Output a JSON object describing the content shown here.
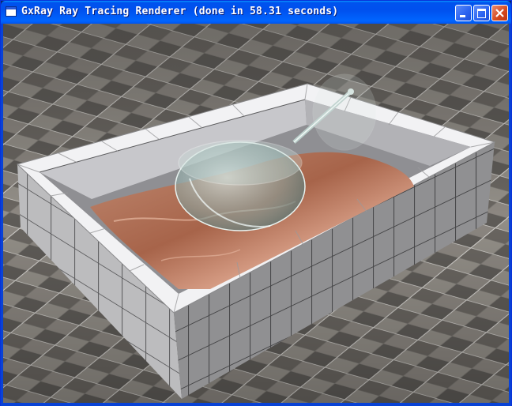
{
  "window": {
    "title": "GxRay Ray Tracing Renderer (done in 58.31 seconds)",
    "icon": "app-window-icon",
    "controls": {
      "minimize": "minimize-icon",
      "maximize": "maximize-icon",
      "close": "close-icon"
    }
  },
  "render": {
    "scene_description_icon": "rendered-scene",
    "colors": {
      "floor_dark": "#4a4845",
      "floor_light": "#8a8680",
      "tile_white": "#e8e8ea",
      "tile_grout": "#3a3a3c",
      "liquid": "#b5735a",
      "glass": "#9fb7b4"
    }
  }
}
